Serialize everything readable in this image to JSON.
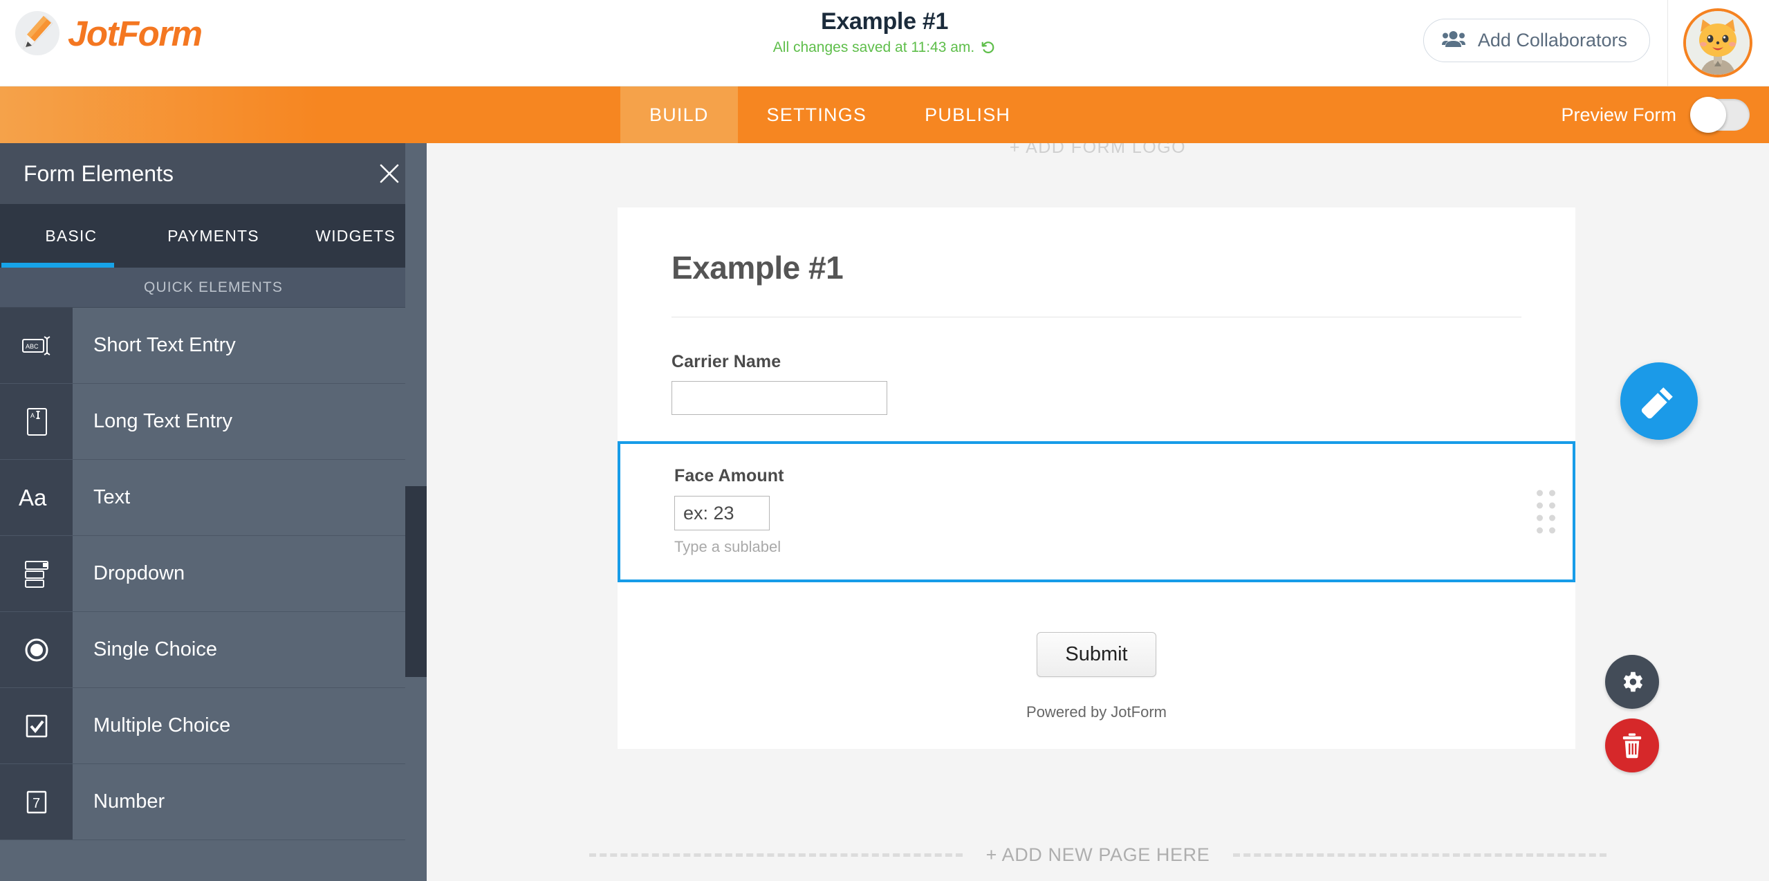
{
  "header": {
    "logo_text": "JotForm",
    "logo_icon": "pencil-icon",
    "form_title": "Example #1",
    "saved_text": "All changes saved at 11:43 am.",
    "undo_icon": "undo-icon",
    "collaborators_label": "Add Collaborators",
    "collaborators_icon": "people-icon",
    "avatar_icon": "cat-avatar",
    "accent_orange": "#f68621",
    "saved_green": "#5ebe4a"
  },
  "navbar": {
    "tabs": [
      {
        "label": "BUILD",
        "active": true
      },
      {
        "label": "SETTINGS",
        "active": false
      },
      {
        "label": "PUBLISH",
        "active": false
      }
    ],
    "preview_label": "Preview Form",
    "preview_toggle_state": "off"
  },
  "panel": {
    "title": "Form Elements",
    "close_icon": "close-icon",
    "tabs": [
      {
        "label": "BASIC",
        "active": true
      },
      {
        "label": "PAYMENTS",
        "active": false
      },
      {
        "label": "WIDGETS",
        "active": false
      }
    ],
    "active_tab_color": "#17a3e8",
    "section_label": "QUICK ELEMENTS",
    "items": [
      {
        "label": "Short Text Entry",
        "icon": "abc-textbox-icon"
      },
      {
        "label": "Long Text Entry",
        "icon": "textarea-icon"
      },
      {
        "label": "Text",
        "icon": "aa-text-icon"
      },
      {
        "label": "Dropdown",
        "icon": "dropdown-icon"
      },
      {
        "label": "Single Choice",
        "icon": "radio-icon"
      },
      {
        "label": "Multiple Choice",
        "icon": "checkbox-icon"
      },
      {
        "label": "Number",
        "icon": "number-icon"
      }
    ]
  },
  "canvas": {
    "ghost_top_text": "+ ADD FORM LOGO",
    "form": {
      "heading": "Example #1",
      "fields": [
        {
          "label": "Carrier Name",
          "value": "",
          "selected": false
        },
        {
          "label": "Face Amount",
          "value": "ex: 23",
          "sublabel": "Type a sublabel",
          "selected": true,
          "selection_color": "#179ce8"
        }
      ],
      "submit_label": "Submit",
      "powered_by": "Powered by JotForm"
    },
    "side_actions": [
      {
        "name": "properties",
        "icon": "gear-icon",
        "color": "#434c58"
      },
      {
        "name": "delete",
        "icon": "trash-icon",
        "color": "#d6282a"
      }
    ],
    "fab_icon": "magic-wand-icon",
    "fab_color": "#1b9ae8",
    "add_page_text": "+ ADD NEW PAGE HERE"
  }
}
